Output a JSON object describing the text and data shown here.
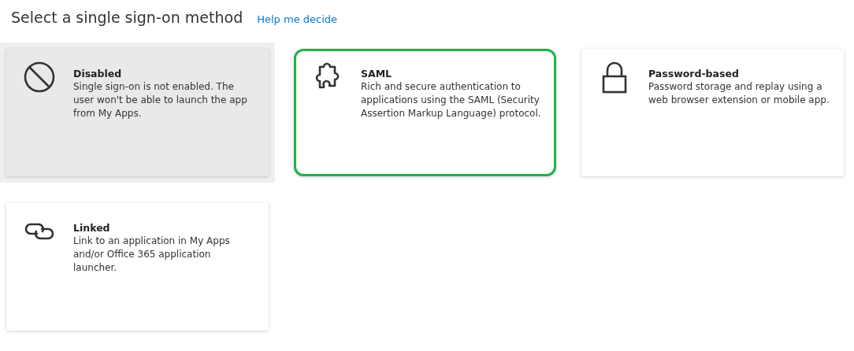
{
  "heading": "Select a single sign-on method",
  "help_link": "Help me decide",
  "methods": [
    {
      "kind": "disabled",
      "title": "Disabled",
      "description": "Single sign-on is not enabled. The user won't be able to launch the app from My Apps.",
      "selected": true,
      "highlighted": false
    },
    {
      "kind": "saml",
      "title": "SAML",
      "description": "Rich and secure authentication to applications using the SAML (Security Assertion Markup Language) protocol.",
      "selected": false,
      "highlighted": true
    },
    {
      "kind": "password",
      "title": "Password-based",
      "description": "Password storage and replay using a web browser extension or mobile app.",
      "selected": false,
      "highlighted": false
    },
    {
      "kind": "linked",
      "title": "Linked",
      "description": "Link to an application in My Apps and/or Office 365 application launcher.",
      "selected": false,
      "highlighted": false
    }
  ]
}
